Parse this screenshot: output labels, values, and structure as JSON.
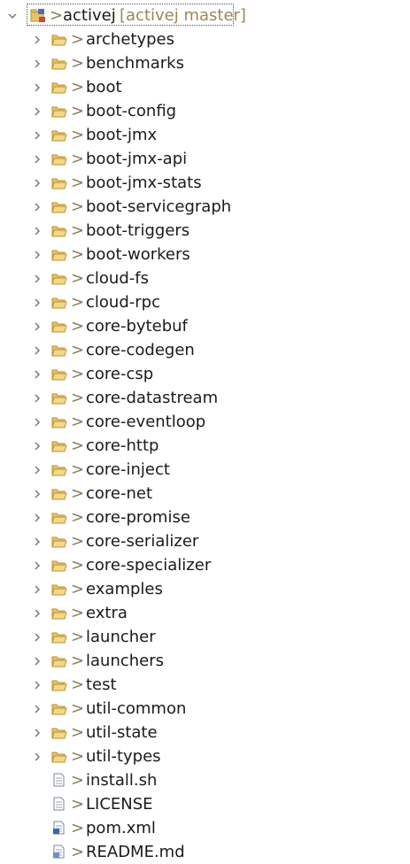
{
  "project": {
    "name": "activej",
    "repo": "[activej master]",
    "expanded": true
  },
  "decoration_prefix": ">",
  "items": [
    {
      "label": "archetypes",
      "type": "folder"
    },
    {
      "label": "benchmarks",
      "type": "folder"
    },
    {
      "label": "boot",
      "type": "folder"
    },
    {
      "label": "boot-config",
      "type": "folder"
    },
    {
      "label": "boot-jmx",
      "type": "folder"
    },
    {
      "label": "boot-jmx-api",
      "type": "folder"
    },
    {
      "label": "boot-jmx-stats",
      "type": "folder"
    },
    {
      "label": "boot-servicegraph",
      "type": "folder"
    },
    {
      "label": "boot-triggers",
      "type": "folder"
    },
    {
      "label": "boot-workers",
      "type": "folder"
    },
    {
      "label": "cloud-fs",
      "type": "folder"
    },
    {
      "label": "cloud-rpc",
      "type": "folder"
    },
    {
      "label": "core-bytebuf",
      "type": "folder"
    },
    {
      "label": "core-codegen",
      "type": "folder"
    },
    {
      "label": "core-csp",
      "type": "folder"
    },
    {
      "label": "core-datastream",
      "type": "folder"
    },
    {
      "label": "core-eventloop",
      "type": "folder"
    },
    {
      "label": "core-http",
      "type": "folder"
    },
    {
      "label": "core-inject",
      "type": "folder"
    },
    {
      "label": "core-net",
      "type": "folder"
    },
    {
      "label": "core-promise",
      "type": "folder"
    },
    {
      "label": "core-serializer",
      "type": "folder"
    },
    {
      "label": "core-specializer",
      "type": "folder"
    },
    {
      "label": "examples",
      "type": "folder"
    },
    {
      "label": "extra",
      "type": "folder"
    },
    {
      "label": "launcher",
      "type": "folder"
    },
    {
      "label": "launchers",
      "type": "folder"
    },
    {
      "label": "test",
      "type": "folder"
    },
    {
      "label": "util-common",
      "type": "folder"
    },
    {
      "label": "util-state",
      "type": "folder"
    },
    {
      "label": "util-types",
      "type": "folder"
    },
    {
      "label": "install.sh",
      "type": "file"
    },
    {
      "label": "LICENSE",
      "type": "file"
    },
    {
      "label": "pom.xml",
      "type": "xml-file"
    },
    {
      "label": "README.md",
      "type": "md-file"
    }
  ],
  "colors": {
    "text": "#1a1a1a",
    "repo": "#a0845c",
    "decoration": "#8a7a5a",
    "folder": "#e8c36a",
    "folder_dark": "#b8922e",
    "twisty": "#7a7a7a"
  }
}
